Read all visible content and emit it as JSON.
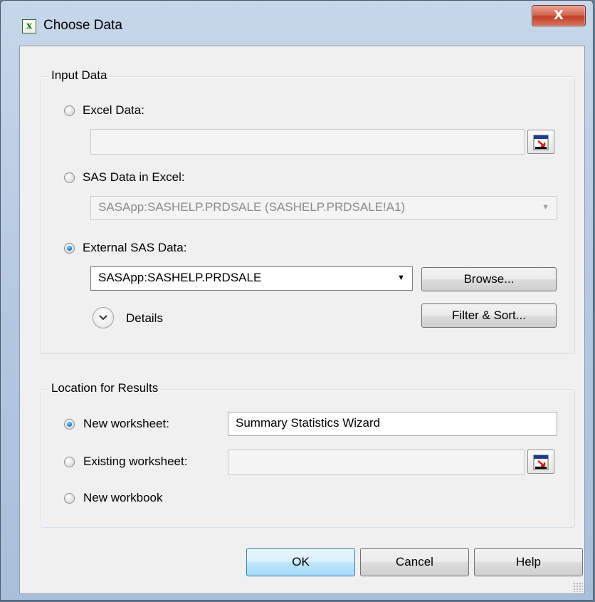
{
  "window": {
    "title": "Choose Data",
    "close_glyph": "X"
  },
  "input_data": {
    "legend": "Input Data",
    "excel_data": {
      "label": "Excel Data:",
      "value": "",
      "selected": false
    },
    "sas_data_in_excel": {
      "label": "SAS Data in Excel:",
      "value": "SASApp:SASHELP.PRDSALE (SASHELP.PRDSALE!A1)",
      "selected": false
    },
    "external_sas_data": {
      "label": "External SAS Data:",
      "value": "SASApp:SASHELP.PRDSALE",
      "selected": true
    },
    "browse_label": "Browse...",
    "filter_sort_label": "Filter & Sort...",
    "details_label": "Details"
  },
  "location": {
    "legend": "Location for Results",
    "new_worksheet": {
      "label": "New worksheet:",
      "value": "Summary Statistics Wizard",
      "selected": true
    },
    "existing_worksheet": {
      "label": "Existing worksheet:",
      "value": "",
      "selected": false
    },
    "new_workbook": {
      "label": "New workbook",
      "selected": false
    }
  },
  "buttons": {
    "ok": "OK",
    "cancel": "Cancel",
    "help": "Help"
  },
  "icons": {
    "app": "excel-x-icon",
    "range_picker": "cell-range-picker-icon",
    "details": "chevron-down-circle-icon"
  },
  "colors": {
    "accent": "#1d7bc9",
    "close": "#c2402a"
  }
}
